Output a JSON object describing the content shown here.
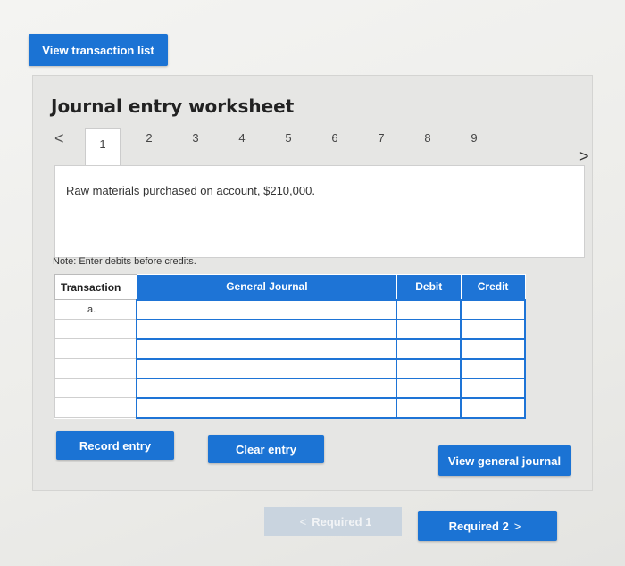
{
  "top_button": {
    "label": "View transaction list"
  },
  "worksheet": {
    "title": "Journal entry worksheet",
    "prev_arrow": "<",
    "next_arrow": ">",
    "tabs": [
      "1",
      "2",
      "3",
      "4",
      "5",
      "6",
      "7",
      "8",
      "9"
    ],
    "active_tab": "1",
    "description": "Raw materials purchased on account, $210,000.",
    "note": "Note: Enter debits before credits."
  },
  "table": {
    "headers": {
      "transaction": "Transaction",
      "journal": "General Journal",
      "debit": "Debit",
      "credit": "Credit"
    },
    "rows": [
      {
        "transaction": "a.",
        "account": "",
        "debit": "",
        "credit": ""
      },
      {
        "transaction": "",
        "account": "",
        "debit": "",
        "credit": ""
      },
      {
        "transaction": "",
        "account": "",
        "debit": "",
        "credit": ""
      },
      {
        "transaction": "",
        "account": "",
        "debit": "",
        "credit": ""
      },
      {
        "transaction": "",
        "account": "",
        "debit": "",
        "credit": ""
      },
      {
        "transaction": "",
        "account": "",
        "debit": "",
        "credit": ""
      }
    ]
  },
  "actions": {
    "record_entry": "Record entry",
    "clear_entry": "Clear entry",
    "view_general_journal": "View general journal"
  },
  "navigation": {
    "required_1": "Required 1",
    "required_2": "Required 2",
    "left_chevron": "<",
    "right_chevron": ">"
  },
  "colors": {
    "accent": "#1b73d4",
    "disabled": "#c9d4df"
  }
}
